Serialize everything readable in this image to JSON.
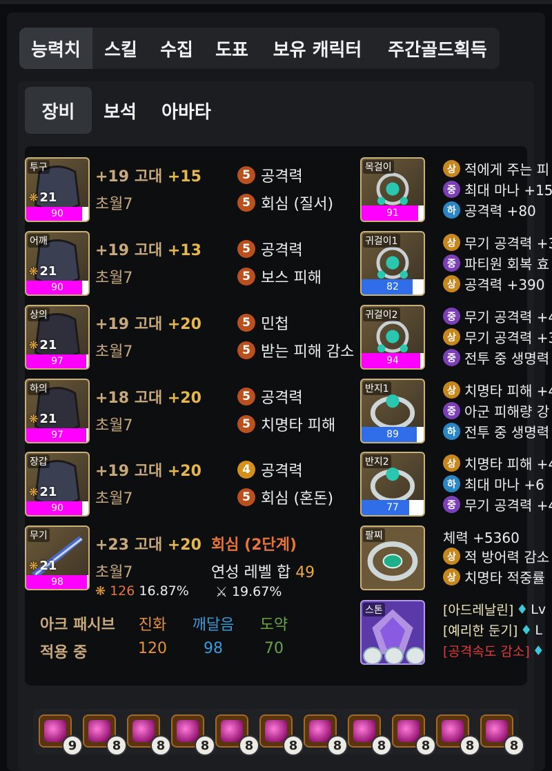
{
  "main_tabs": [
    "능력치",
    "스킬",
    "수집",
    "도표",
    "보유 캐릭터",
    "주간골드획득"
  ],
  "sub_tabs": [
    "장비",
    "보석",
    "아바타"
  ],
  "equipment": [
    {
      "slot": "투구",
      "level": "21",
      "quality": 90,
      "quality_text": "90",
      "name_prefix": "+19 고대 ",
      "honing": "+15",
      "set": "초월7",
      "engravings": [
        {
          "num": "5",
          "name": "공격력"
        },
        {
          "num": "5",
          "name": "회심 (질서)"
        }
      ]
    },
    {
      "slot": "어깨",
      "level": "21",
      "quality": 90,
      "quality_text": "90",
      "name_prefix": "+19 고대 ",
      "honing": "+13",
      "set": "초월7",
      "engravings": [
        {
          "num": "5",
          "name": "공격력"
        },
        {
          "num": "5",
          "name": "보스 피해"
        }
      ]
    },
    {
      "slot": "상의",
      "level": "21",
      "quality": 97,
      "quality_text": "97",
      "name_prefix": "+19 고대 ",
      "honing": "+20",
      "set": "초월7",
      "engravings": [
        {
          "num": "5",
          "name": "민첩"
        },
        {
          "num": "5",
          "name": "받는 피해 감소"
        }
      ]
    },
    {
      "slot": "하의",
      "level": "21",
      "quality": 97,
      "quality_text": "97",
      "name_prefix": "+18 고대 ",
      "honing": "+20",
      "set": "초월7",
      "engravings": [
        {
          "num": "5",
          "name": "공격력"
        },
        {
          "num": "5",
          "name": "치명타 피해"
        }
      ]
    },
    {
      "slot": "장갑",
      "level": "21",
      "quality": 90,
      "quality_text": "90",
      "name_prefix": "+19 고대 ",
      "honing": "+20",
      "set": "초월7",
      "engravings": [
        {
          "num": "4",
          "name": "공격력"
        },
        {
          "num": "5",
          "name": "회심 (혼돈)"
        }
      ]
    },
    {
      "slot": "무기",
      "level": "21",
      "quality": 98,
      "quality_text": "98",
      "name_prefix": "+23 고대 ",
      "honing": "+20",
      "set": "초월7"
    }
  ],
  "weapon_extra": {
    "effect": "회심 (2단계)",
    "elixir_label": "연성 레벨 합",
    "elixir_value": "49",
    "transcend_total": "126",
    "transcend_pct": "16.87%",
    "attack_pct": "19.67%"
  },
  "ark_passive": {
    "label1": "아크 패시브",
    "label2": "적용 중",
    "cols": [
      {
        "name": "진화",
        "value": "120",
        "color": "#e8913a"
      },
      {
        "name": "깨달음",
        "value": "98",
        "color": "#3a9ad9"
      },
      {
        "name": "도약",
        "value": "70",
        "color": "#6aa34a"
      }
    ]
  },
  "accessories": [
    {
      "slot": "목걸이",
      "quality": 91,
      "quality_text": "91",
      "bar_color": "#ff00ff",
      "options": [
        {
          "grade": "상",
          "tier": "high",
          "text": "적에게 주는 피"
        },
        {
          "grade": "중",
          "tier": "mid",
          "text": "최대 마나 +15"
        },
        {
          "grade": "하",
          "tier": "low",
          "text": "공격력 +80"
        }
      ]
    },
    {
      "slot": "귀걸이1",
      "quality": 82,
      "quality_text": "82",
      "bar_color": "#2f6ee8",
      "options": [
        {
          "grade": "상",
          "tier": "high",
          "text": "무기 공격력 +3"
        },
        {
          "grade": "중",
          "tier": "mid",
          "text": "파티원 회복 효"
        },
        {
          "grade": "상",
          "tier": "high",
          "text": "공격력 +390"
        }
      ]
    },
    {
      "slot": "귀걸이2",
      "quality": 94,
      "quality_text": "94",
      "bar_color": "#ff00ff",
      "options": [
        {
          "grade": "중",
          "tier": "mid",
          "text": "무기 공격력 +4"
        },
        {
          "grade": "상",
          "tier": "high",
          "text": "무기 공격력 +3"
        },
        {
          "grade": "중",
          "tier": "mid",
          "text": "전투 중 생명력"
        }
      ]
    },
    {
      "slot": "반지1",
      "quality": 89,
      "quality_text": "89",
      "bar_color": "#2f6ee8",
      "options": [
        {
          "grade": "상",
          "tier": "high",
          "text": "치명타 피해 +4"
        },
        {
          "grade": "중",
          "tier": "mid",
          "text": "아군 피해량 강"
        },
        {
          "grade": "하",
          "tier": "low",
          "text": "전투 중 생명력"
        }
      ]
    },
    {
      "slot": "반지2",
      "quality": 77,
      "quality_text": "77",
      "bar_color": "#2f6ee8",
      "options": [
        {
          "grade": "상",
          "tier": "high",
          "text": "치명타 피해 +4"
        },
        {
          "grade": "하",
          "tier": "low",
          "text": "최대 마나 +6"
        },
        {
          "grade": "중",
          "tier": "mid",
          "text": "무기 공격력 +4"
        }
      ]
    }
  ],
  "bracelet": {
    "slot": "팔찌",
    "stat": "체력 +5360",
    "options": [
      {
        "grade": "상",
        "tier": "high",
        "text": "적 방어력 감소"
      },
      {
        "grade": "상",
        "tier": "high",
        "text": "치명타 적중률"
      }
    ]
  },
  "stone": {
    "slot": "스톤",
    "engravings": [
      {
        "text": "[아드레날린]",
        "suffix": "Lv",
        "color": "#f0e6b8"
      },
      {
        "text": "[예리한 둔기]",
        "suffix": "L",
        "color": "#f0e6b8"
      },
      {
        "text": "[공격속도 감소]",
        "suffix": "",
        "color": "#e03a3a"
      }
    ]
  },
  "gems": [
    "9",
    "8",
    "8",
    "8",
    "8",
    "8",
    "8",
    "8",
    "8",
    "8",
    "8"
  ]
}
